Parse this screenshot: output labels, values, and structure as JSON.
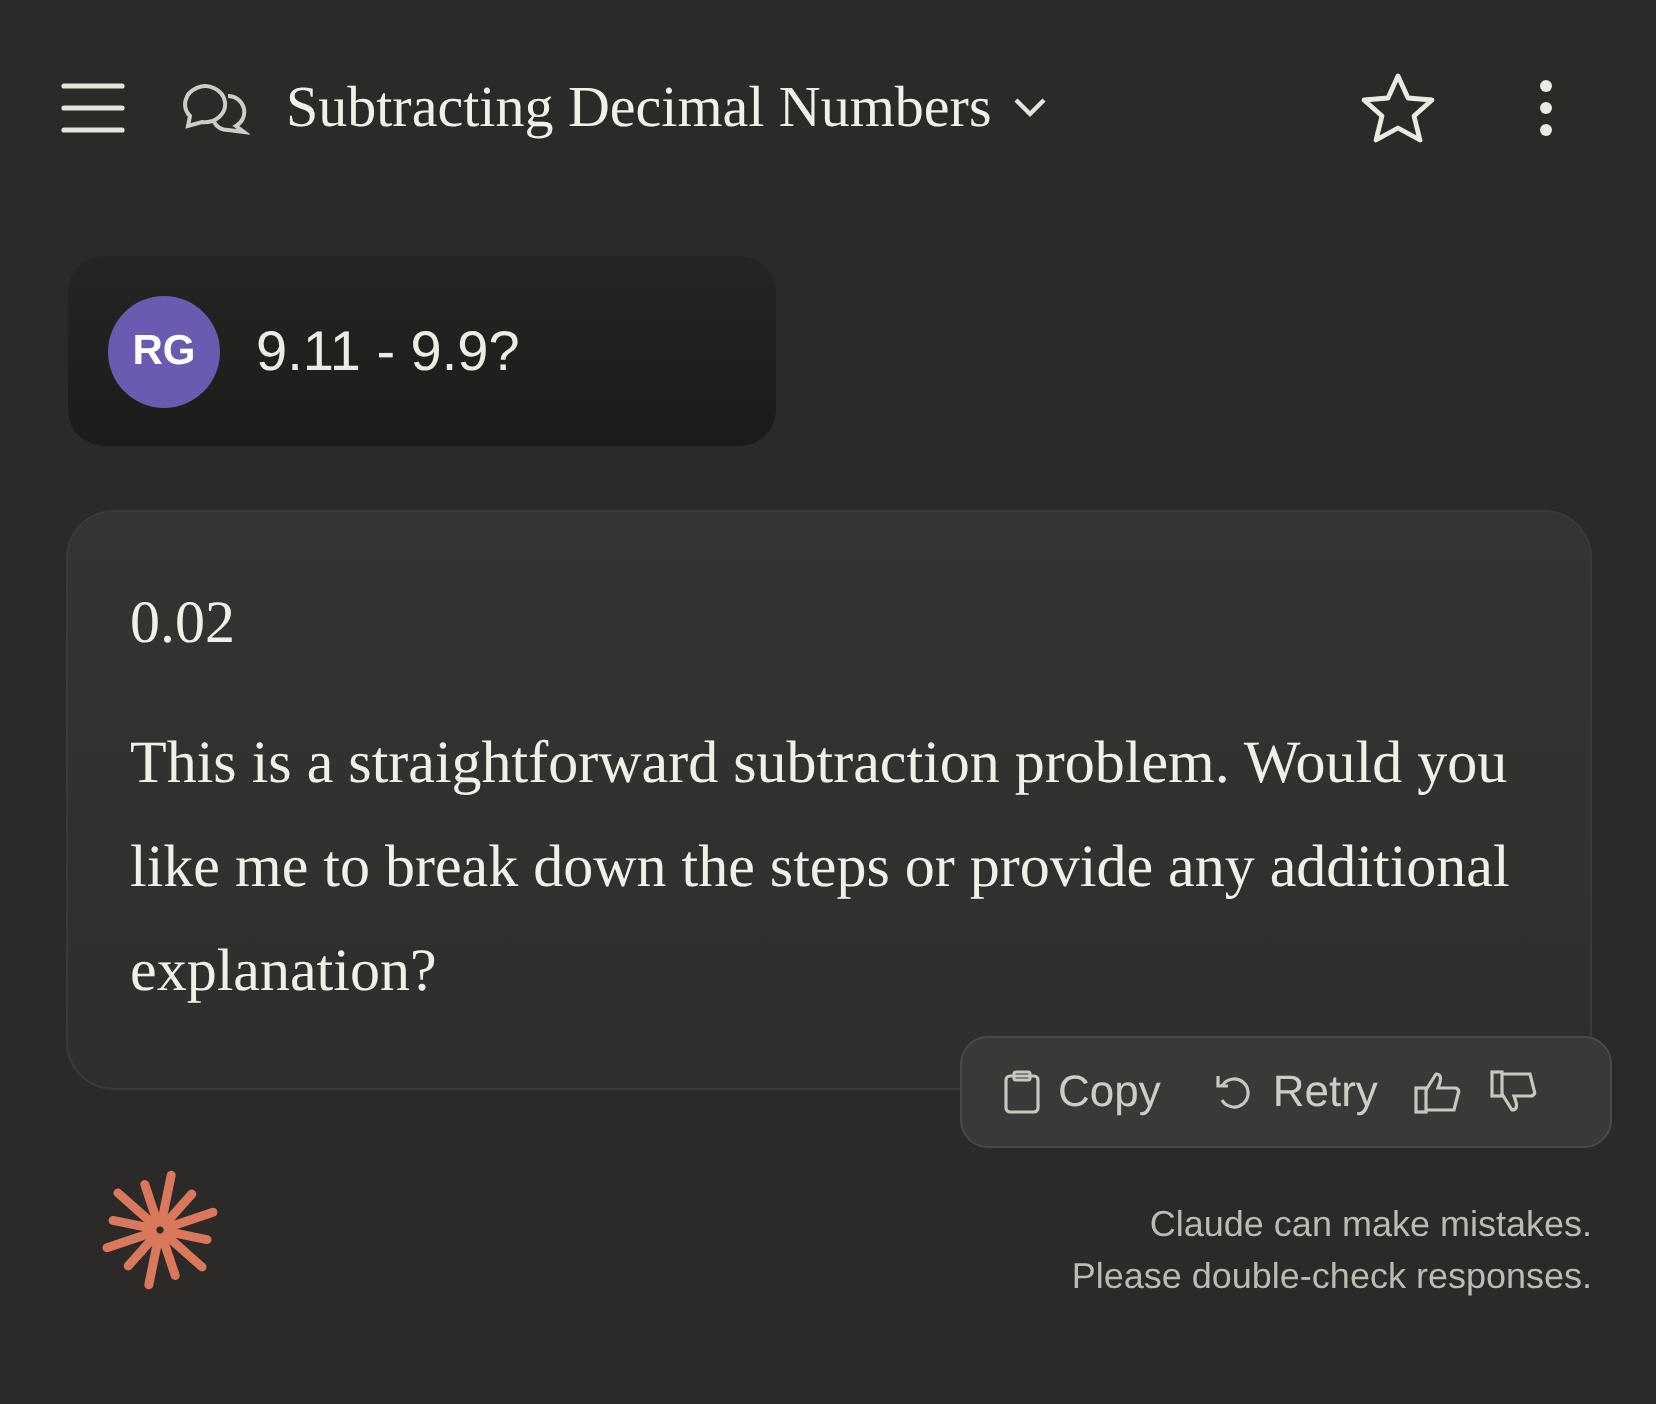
{
  "header": {
    "title": "Subtracting Decimal Numbers"
  },
  "user_message": {
    "avatar": "RG",
    "text": "9.11 - 9.9?"
  },
  "response": {
    "paragraphs": [
      "0.02",
      "This is a straightforward subtraction problem. Would you like me to break down the steps or provide any additional explanation?"
    ]
  },
  "actions": [
    {
      "kind": "copy",
      "label": "Copy"
    },
    {
      "kind": "retry",
      "label": "Retry"
    },
    {
      "kind": "thumbs_up"
    },
    {
      "kind": "thumbs_down"
    }
  ],
  "disclaimer": [
    "Claude can make mistakes.",
    "Please double-check responses."
  ]
}
